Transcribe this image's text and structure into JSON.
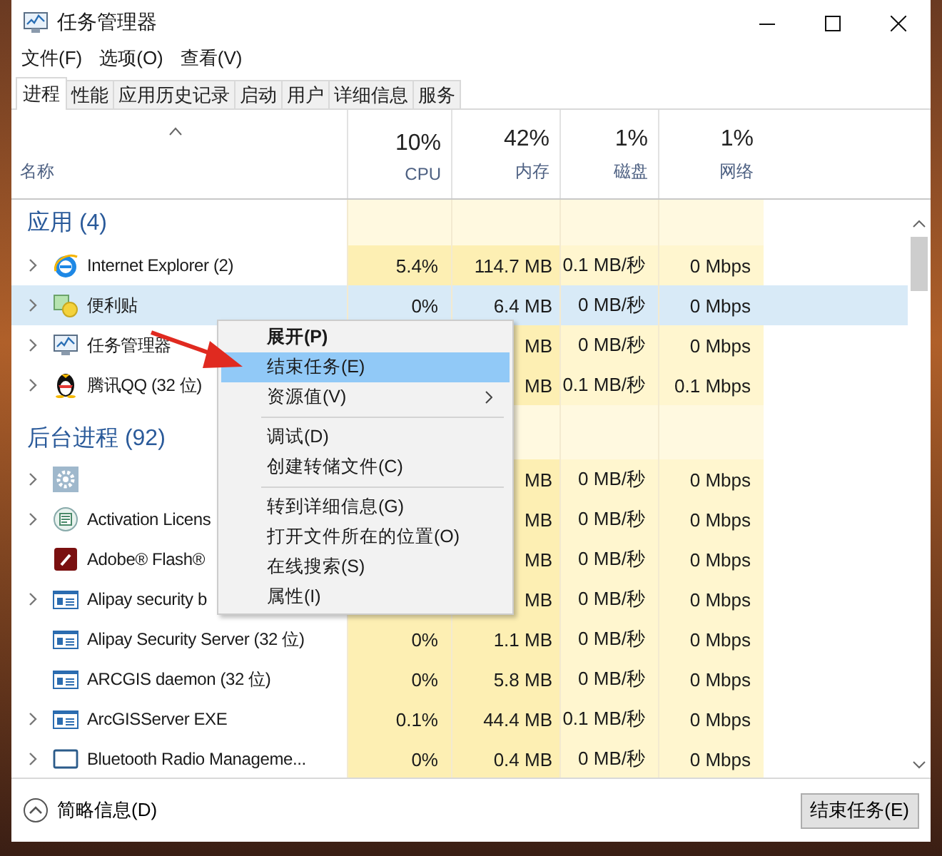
{
  "window": {
    "title": "任务管理器"
  },
  "menu": [
    "文件(F)",
    "选项(O)",
    "查看(V)"
  ],
  "tabs": [
    {
      "label": "进程",
      "selected": true
    },
    {
      "label": "性能",
      "selected": false
    },
    {
      "label": "应用历史记录",
      "selected": false
    },
    {
      "label": "启动",
      "selected": false
    },
    {
      "label": "用户",
      "selected": false
    },
    {
      "label": "详细信息",
      "selected": false
    },
    {
      "label": "服务",
      "selected": false
    }
  ],
  "name_header": "名称",
  "columns": [
    {
      "percent": "10%",
      "label": "CPU"
    },
    {
      "percent": "42%",
      "label": "内存"
    },
    {
      "percent": "1%",
      "label": "磁盘"
    },
    {
      "percent": "1%",
      "label": "网络"
    }
  ],
  "groups": [
    {
      "title": "应用 (4)",
      "rows": [
        {
          "name": "Internet Explorer (2)",
          "expandable": true,
          "selected": false,
          "cpu": "5.4%",
          "memory": "114.7 MB",
          "disk": "0.1 MB/秒",
          "network": "0 Mbps"
        },
        {
          "name": "便利贴",
          "expandable": true,
          "selected": true,
          "cpu": "0%",
          "memory": "6.4 MB",
          "disk": "0 MB/秒",
          "network": "0 Mbps"
        },
        {
          "name": "任务管理器",
          "expandable": true,
          "selected": false,
          "memory": "MB",
          "disk": "0 MB/秒",
          "network": "0 Mbps"
        },
        {
          "name": "腾讯QQ (32 位)",
          "expandable": true,
          "selected": false,
          "memory": "MB",
          "disk": "0.1 MB/秒",
          "network": "0.1 Mbps"
        }
      ]
    },
    {
      "title": "后台进程 (92)",
      "rows": [
        {
          "expandable": true,
          "selected": false,
          "memory": "MB",
          "disk": "0 MB/秒",
          "network": "0 Mbps"
        },
        {
          "name": "Activation Licens",
          "expandable": true,
          "selected": false,
          "memory": "MB",
          "disk": "0 MB/秒",
          "network": "0 Mbps"
        },
        {
          "name": "Adobe® Flash®",
          "expandable": false,
          "selected": false,
          "memory": "MB",
          "disk": "0 MB/秒",
          "network": "0 Mbps"
        },
        {
          "name": "Alipay security b",
          "expandable": true,
          "selected": false,
          "memory": "MB",
          "disk": "0 MB/秒",
          "network": "0 Mbps"
        },
        {
          "name": "Alipay Security Server (32 位)",
          "expandable": false,
          "selected": false,
          "cpu": "0%",
          "memory": "1.1 MB",
          "disk": "0 MB/秒",
          "network": "0 Mbps"
        },
        {
          "name": "ARCGIS daemon (32 位)",
          "expandable": false,
          "selected": false,
          "cpu": "0%",
          "memory": "5.8 MB",
          "disk": "0 MB/秒",
          "network": "0 Mbps"
        },
        {
          "name": "ArcGISServer EXE",
          "expandable": true,
          "selected": false,
          "cpu": "0.1%",
          "memory": "44.4 MB",
          "disk": "0.1 MB/秒",
          "network": "0 Mbps"
        },
        {
          "name": "Bluetooth Radio Manageme...",
          "expandable": true,
          "selected": false,
          "cpu": "0%",
          "memory": "0.4 MB",
          "disk": "0 MB/秒",
          "network": "0 Mbps"
        }
      ]
    }
  ],
  "context_menu": [
    {
      "kind": "item",
      "label": "展开(P)",
      "default": true,
      "submenu": false,
      "selected": false
    },
    {
      "kind": "item",
      "label": "结束任务(E)",
      "default": false,
      "submenu": false,
      "selected": true
    },
    {
      "kind": "item",
      "label": "资源值(V)",
      "default": false,
      "submenu": true,
      "selected": false
    },
    {
      "kind": "separator"
    },
    {
      "kind": "item",
      "label": "调试(D)",
      "default": false,
      "submenu": false,
      "selected": false
    },
    {
      "kind": "item",
      "label": "创建转储文件(C)",
      "default": false,
      "submenu": false,
      "selected": false
    },
    {
      "kind": "separator"
    },
    {
      "kind": "item",
      "label": "转到详细信息(G)",
      "default": false,
      "submenu": false,
      "selected": false
    },
    {
      "kind": "item",
      "label": "打开文件所在的位置(O)",
      "default": false,
      "submenu": false,
      "selected": false
    },
    {
      "kind": "item",
      "label": "在线搜索(S)",
      "default": false,
      "submenu": false,
      "selected": false
    },
    {
      "kind": "item",
      "label": "属性(I)",
      "default": false,
      "submenu": false,
      "selected": false
    }
  ],
  "footer": {
    "details_toggle": "简略信息(D)",
    "end_task_button": "结束任务(E)"
  }
}
